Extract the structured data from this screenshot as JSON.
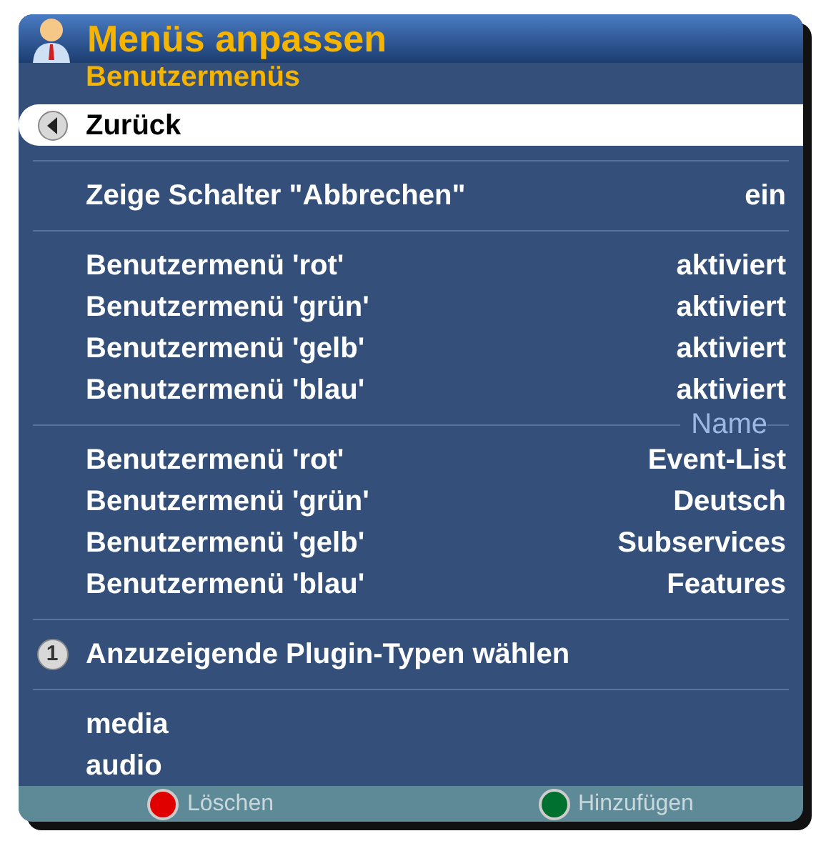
{
  "window": {
    "title": "Menüs anpassen",
    "subtitle": "Benutzermenüs"
  },
  "items": [
    {
      "kind": "back",
      "label": "Zurück",
      "selected": true
    },
    {
      "kind": "separator"
    },
    {
      "kind": "option",
      "label": "Zeige Schalter \"Abbrechen\"",
      "value": "ein",
      "selected": false
    },
    {
      "kind": "separator"
    },
    {
      "kind": "option",
      "label": "Benutzermenü 'rot'",
      "value": "aktiviert",
      "selected": false
    },
    {
      "kind": "option",
      "label": "Benutzermenü 'grün'",
      "value": "aktiviert",
      "selected": false
    },
    {
      "kind": "option",
      "label": "Benutzermenü 'gelb'",
      "value": "aktiviert",
      "selected": false
    },
    {
      "kind": "option",
      "label": "Benutzermenü 'blau'",
      "value": "aktiviert",
      "selected": false
    },
    {
      "kind": "separator",
      "label": "Name"
    },
    {
      "kind": "option",
      "label": "Benutzermenü 'rot'",
      "value": "Event-List",
      "selected": false
    },
    {
      "kind": "option",
      "label": "Benutzermenü 'grün'",
      "value": "Deutsch",
      "selected": false
    },
    {
      "kind": "option",
      "label": "Benutzermenü 'gelb'",
      "value": "Subservices",
      "selected": false
    },
    {
      "kind": "option",
      "label": "Benutzermenü 'blau'",
      "value": "Features",
      "selected": false
    },
    {
      "kind": "separator"
    },
    {
      "kind": "numbered",
      "key": "1",
      "label": "Anzuzeigende Plugin-Typen wählen",
      "selected": false
    },
    {
      "kind": "separator"
    },
    {
      "kind": "option",
      "label": "media",
      "selected": false
    },
    {
      "kind": "option",
      "label": "audio",
      "selected": false
    }
  ],
  "footer": [
    {
      "label": "Löschen",
      "color": "#e00000"
    },
    {
      "label": "Hinzufügen",
      "color": "#007030"
    }
  ]
}
